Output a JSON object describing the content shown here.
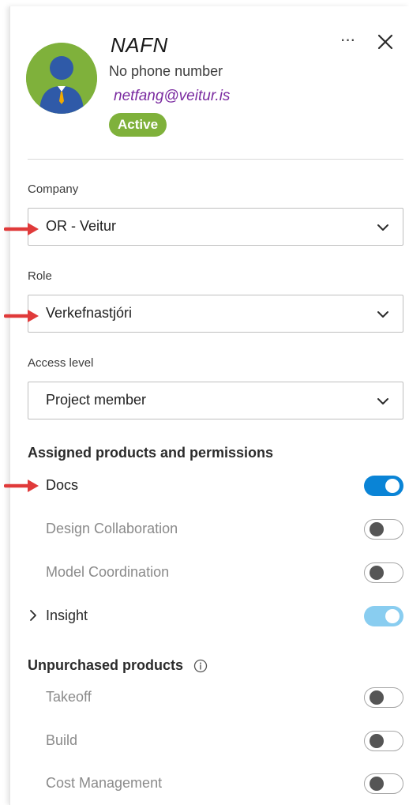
{
  "user": {
    "name": "NAFN",
    "phone": "No phone number",
    "email": "netfang@veitur.is",
    "status": "Active"
  },
  "header": {
    "more_label": "···"
  },
  "fields": {
    "company": {
      "label": "Company",
      "value": "OR - Veitur"
    },
    "role": {
      "label": "Role",
      "value": "Verkefnastjóri"
    },
    "access": {
      "label": "Access level",
      "value": "Project member"
    }
  },
  "assigned": {
    "title": "Assigned products and permissions",
    "items": [
      {
        "label": "Docs",
        "state": "on"
      },
      {
        "label": "Design Collaboration",
        "state": "off"
      },
      {
        "label": "Model Coordination",
        "state": "off"
      },
      {
        "label": "Insight",
        "state": "on-disabled"
      }
    ]
  },
  "unpurchased": {
    "title": "Unpurchased products",
    "items": [
      {
        "label": "Takeoff",
        "state": "off"
      },
      {
        "label": "Build",
        "state": "off"
      },
      {
        "label": "Cost Management",
        "state": "off"
      }
    ]
  },
  "colors": {
    "accent_green": "#7fb13b",
    "toggle_on": "#0a84d6",
    "toggle_on_disabled": "#89cdf0",
    "email": "#7a2aa0",
    "annotation_arrow": "#e03a3a"
  },
  "icons": [
    "user-avatar-icon",
    "more-icon",
    "close-icon",
    "chevron-down-icon",
    "chevron-right-icon",
    "info-icon",
    "red-arrow-annotation"
  ]
}
